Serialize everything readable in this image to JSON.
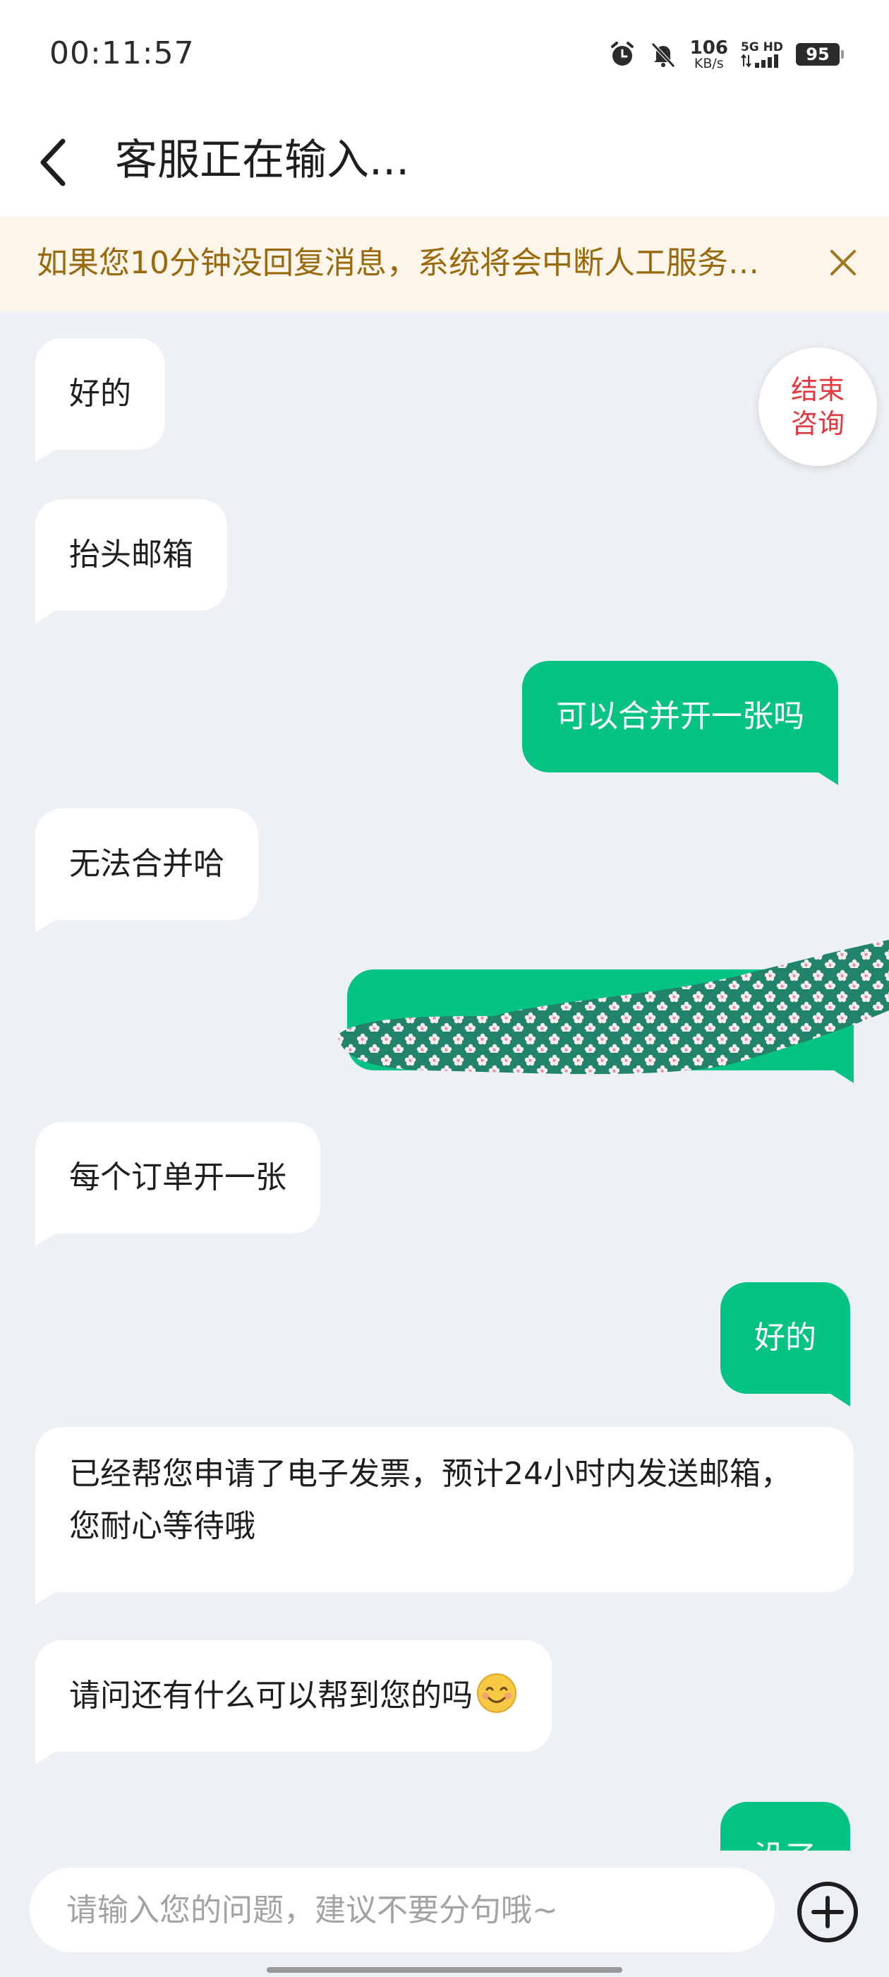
{
  "status_bar": {
    "time": "00:11:57",
    "net_speed": "106",
    "net_unit": "KB/s",
    "signal_label": "5G HD",
    "battery": "95"
  },
  "header": {
    "title": "客服正在输入..."
  },
  "notice": {
    "text": "如果您10分钟没回复消息，系统将会中断人工服务…"
  },
  "end_button": {
    "line1": "结束",
    "line2": "咨询"
  },
  "messages": [
    {
      "side": "left",
      "text": "好的"
    },
    {
      "side": "left",
      "text": "抬头邮箱"
    },
    {
      "side": "right",
      "text": "可以合并开一张吗"
    },
    {
      "side": "left",
      "text": "无法合并哈"
    },
    {
      "side": "right",
      "text": ""
    },
    {
      "side": "left",
      "text": "每个订单开一张"
    },
    {
      "side": "right",
      "text": "好的"
    },
    {
      "side": "left",
      "text": "已经帮您申请了电子发票，预计24小时内发送邮箱，您耐心等待哦"
    },
    {
      "side": "left",
      "text": "请问还有什么可以帮到您的吗"
    },
    {
      "side": "right",
      "text": "没了"
    }
  ],
  "input": {
    "placeholder": "请输入您的问题，建议不要分句哦~"
  },
  "colors": {
    "accent_green": "#07c383",
    "notice_bg": "#fdf5e9",
    "notice_text": "#99690e",
    "end_button_text": "#e5383e",
    "chat_bg": "#edf0f5"
  },
  "icons": [
    "alarm-icon",
    "mute-icon",
    "signal-icon",
    "battery-icon",
    "back-arrow-icon",
    "close-icon",
    "smile-emoji-icon",
    "plus-circle-icon"
  ]
}
